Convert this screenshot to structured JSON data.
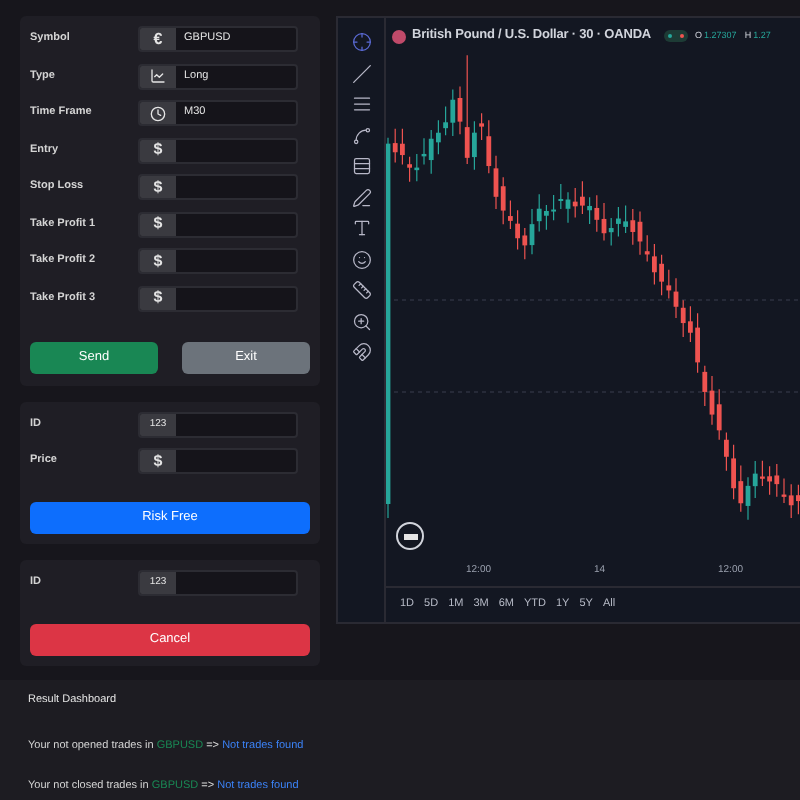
{
  "order_form": {
    "fields": [
      {
        "label": "Symbol",
        "kind": "text",
        "addon": "€",
        "value": "GBPUSD"
      },
      {
        "label": "Type",
        "kind": "chart",
        "value": "Long"
      },
      {
        "label": "Time Frame",
        "kind": "clock",
        "value": "M30"
      },
      {
        "label": "Entry",
        "kind": "text",
        "addon": "$"
      },
      {
        "label": "Stop Loss",
        "kind": "text",
        "addon": "$"
      },
      {
        "label": "Take Profit 1",
        "kind": "text",
        "addon": "$"
      },
      {
        "label": "Take Profit 2",
        "kind": "text",
        "addon": "$"
      },
      {
        "label": "Take Profit 3",
        "kind": "text",
        "addon": "$"
      }
    ],
    "buttons": [
      {
        "label": "Send",
        "kind": "send"
      },
      {
        "label": "Exit",
        "kind": "exit"
      }
    ]
  },
  "risk_free_form": {
    "fields": [
      {
        "label": "ID",
        "kind": "code",
        "addon": "123"
      },
      {
        "label": "Price",
        "kind": "text",
        "addon": "$"
      }
    ],
    "button": {
      "label": "Risk Free",
      "kind": "risk"
    }
  },
  "cancel_form": {
    "fields": [
      {
        "label": "ID",
        "kind": "code",
        "addon": "123"
      }
    ],
    "button": {
      "label": "Cancel",
      "kind": "cancel"
    }
  },
  "chart": {
    "title": "British Pound / U.S. Dollar · 30 · OANDA",
    "ohlc": [
      {
        "key": "O",
        "value": "1.27307"
      },
      {
        "key": "H",
        "value": "1.27"
      }
    ],
    "x_labels": [
      "12:00",
      "14",
      "12:00"
    ],
    "ranges": [
      "1D",
      "5D",
      "1M",
      "3M",
      "6M",
      "YTD",
      "1Y",
      "5Y",
      "All"
    ]
  },
  "dashboard": {
    "title": "Result Dashboard",
    "lines": [
      {
        "text": "Your not opened trades in",
        "symbol": "GBPUSD",
        "arrow": "=>",
        "result": "Not trades found"
      },
      {
        "text": "Your not closed trades in",
        "symbol": "GBPUSD",
        "arrow": "=>",
        "result": "Not trades found"
      }
    ]
  }
}
